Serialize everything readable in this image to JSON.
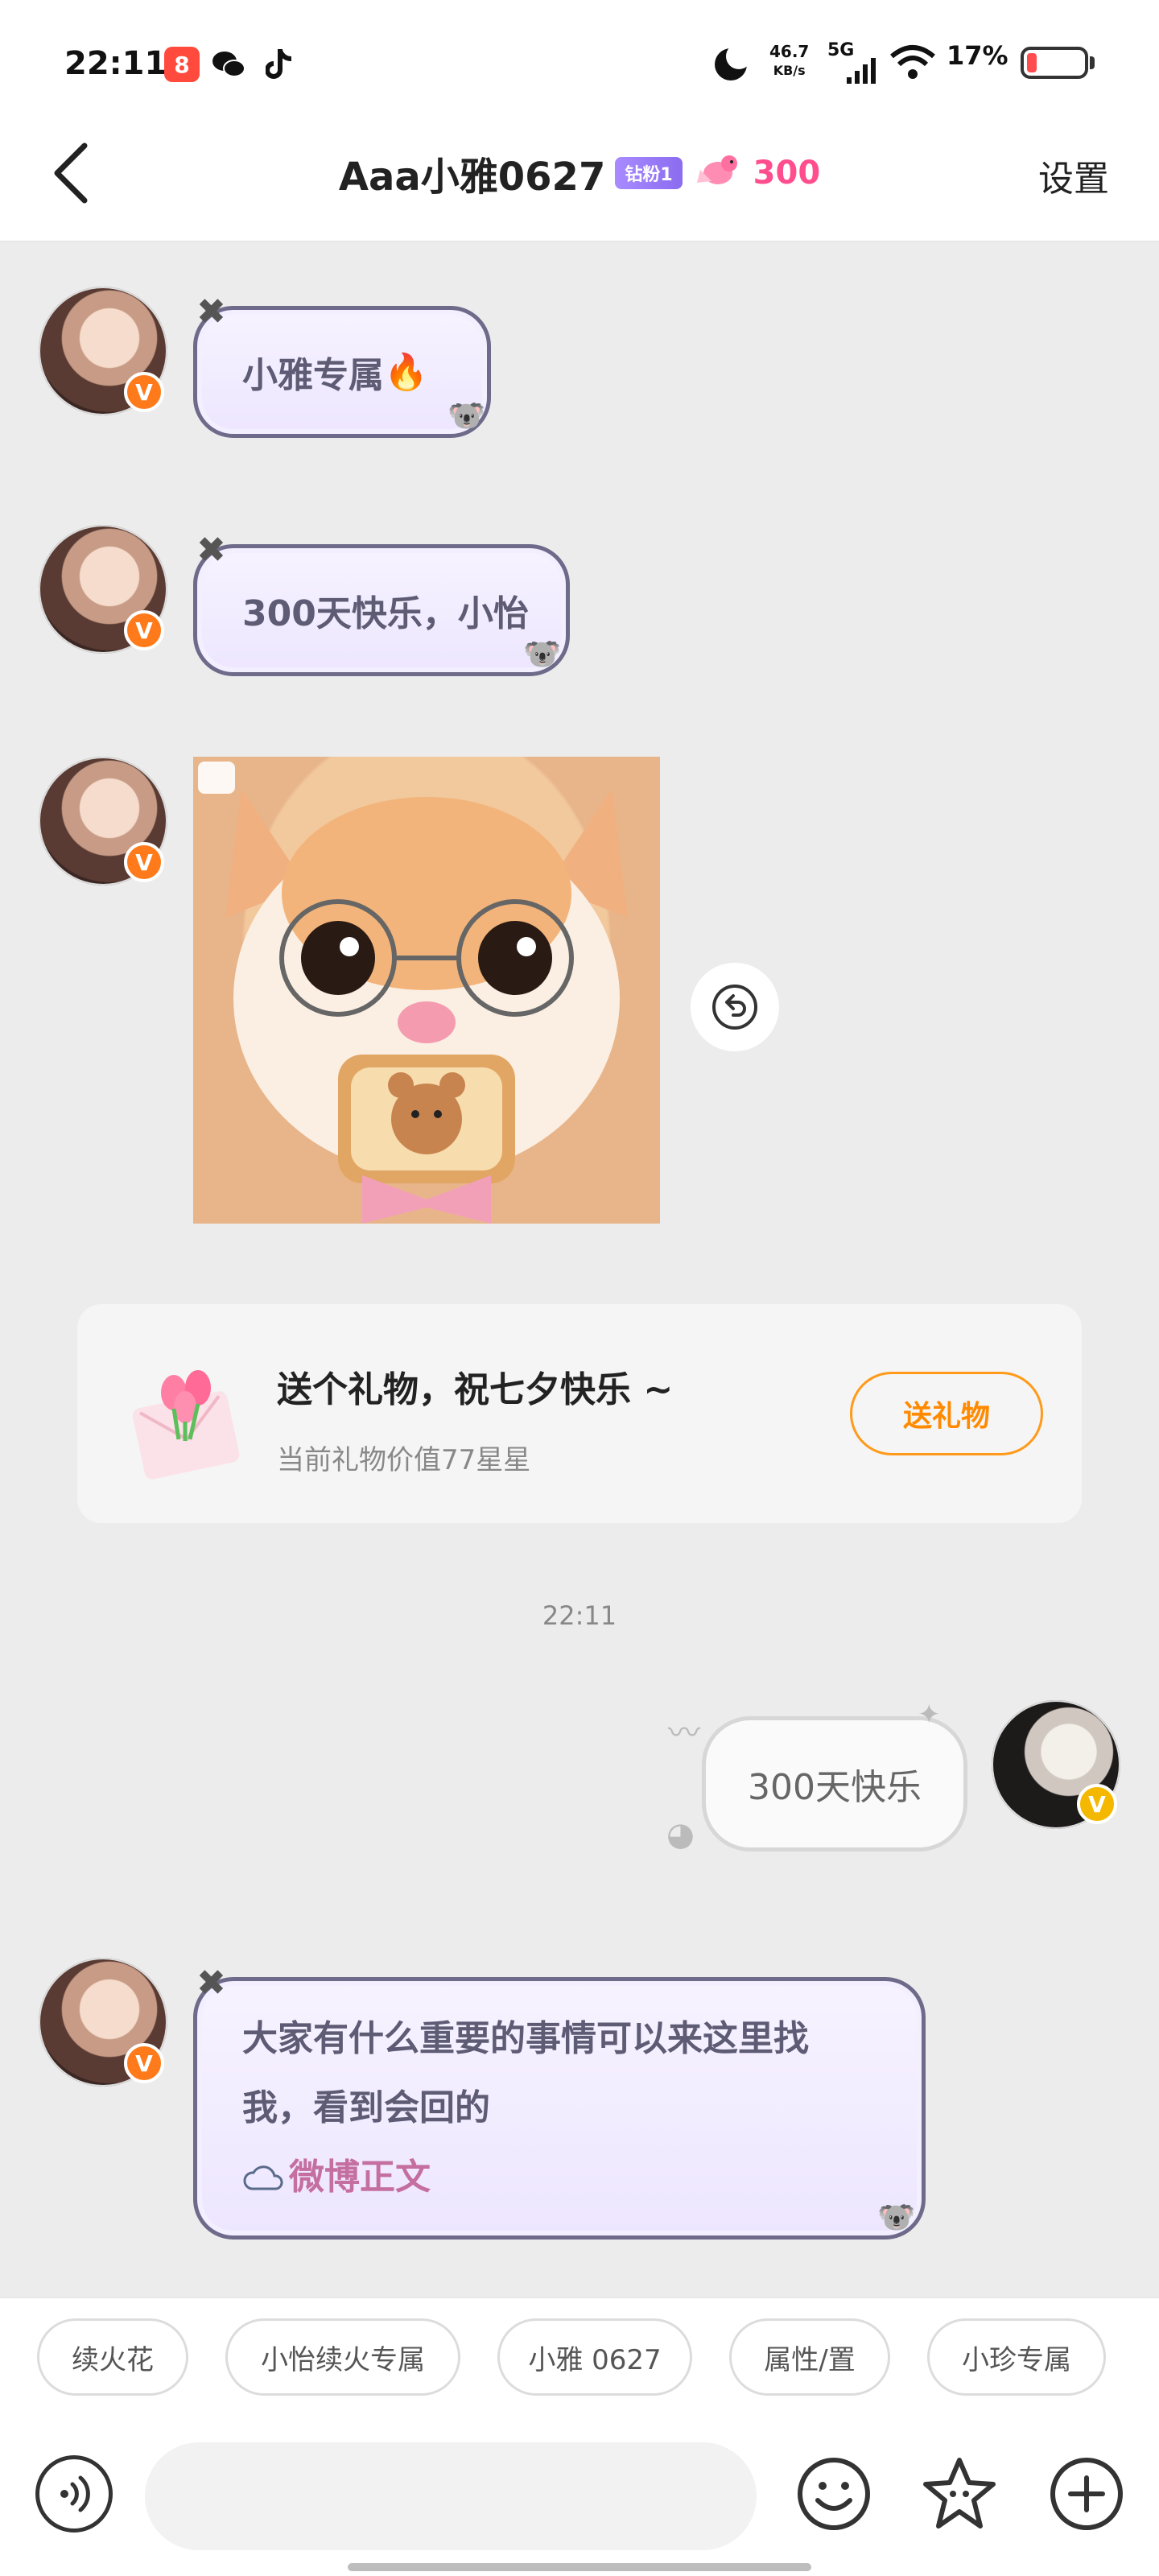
{
  "status_bar": {
    "time": "22:11",
    "net_speed_value": "46.7",
    "net_speed_unit": "KB/s",
    "network": "5G",
    "battery": "17%"
  },
  "header": {
    "title": "Aaa小雅0627",
    "fan_badge": "钻粉1",
    "intimacy_value": "300",
    "settings": "设置"
  },
  "messages": [
    {
      "text": "小雅专属",
      "emoji": "🔥"
    },
    {
      "text": "300天快乐，小怡"
    },
    {
      "text_line1": "大家有什么重要的事情可以来这里找",
      "text_line2": "我，看到会回的",
      "link": "微博正文"
    }
  ],
  "gift_card": {
    "title": "送个礼物，祝七夕快乐 ~",
    "subtitle": "当前礼物价值77星星",
    "button": "送礼物"
  },
  "timestamp": "22:11",
  "my_message": "300天快乐",
  "quick_tags": [
    "续火花",
    "小怡续火专属",
    "小雅 0627",
    "属性/置",
    "小珍专属"
  ],
  "input": {
    "placeholder": ""
  },
  "badges": {
    "v": "V"
  },
  "colors": {
    "accent_orange": "#ff8a00",
    "intimacy_pink": "#ff4d8d",
    "bubble_border": "#6e6a8a"
  }
}
